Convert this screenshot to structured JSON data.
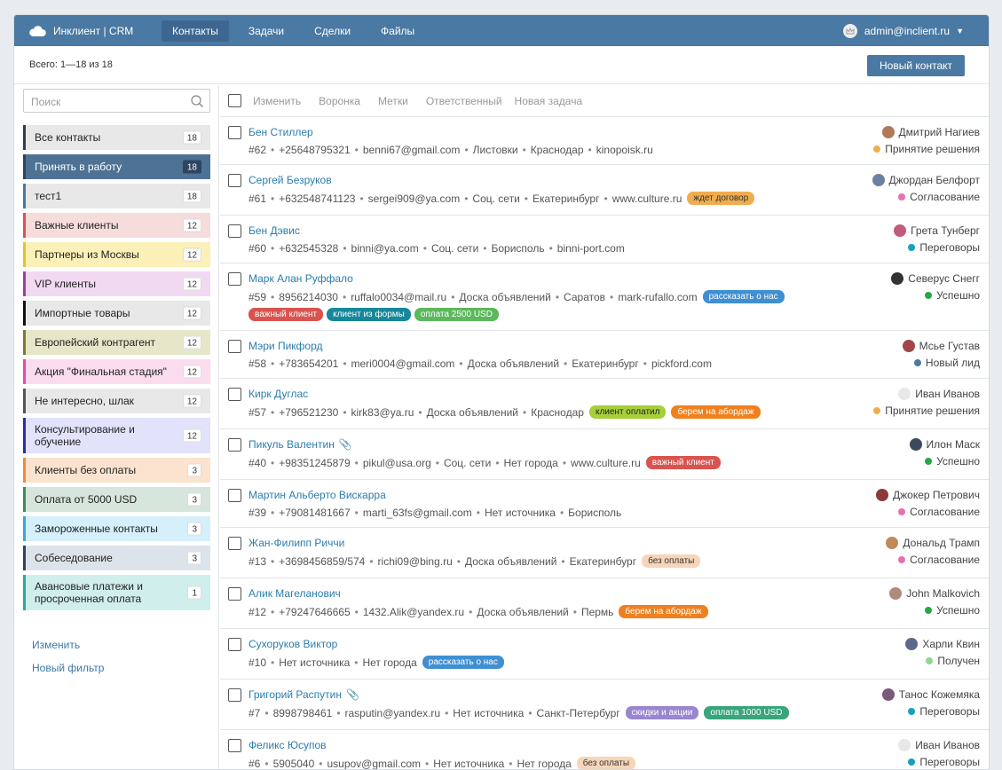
{
  "app": {
    "brand": "Инклиент | CRM"
  },
  "nav": [
    {
      "label": "Контакты",
      "active": true
    },
    {
      "label": "Задачи",
      "active": false
    },
    {
      "label": "Сделки",
      "active": false
    },
    {
      "label": "Файлы",
      "active": false
    }
  ],
  "user": {
    "email": "admin@inclient.ru"
  },
  "summary": {
    "total": "Всего: 1—18 из 18",
    "new_contact": "Новый контакт"
  },
  "search": {
    "placeholder": "Поиск"
  },
  "filters": [
    {
      "label": "Все контакты",
      "count": "18",
      "bg": "#e8e8e8",
      "border": "#2d3e50",
      "active": false
    },
    {
      "label": "Принять в работу",
      "count": "18",
      "bg": "#4e7294",
      "border": "#2d4560",
      "active": true
    },
    {
      "label": "тест1",
      "count": "18",
      "bg": "#e8e8e8",
      "border": "#4a79a3",
      "active": false
    },
    {
      "label": "Важные клиенты",
      "count": "12",
      "bg": "#f7dcdc",
      "border": "#d9534f",
      "active": false
    },
    {
      "label": "Партнеры из Москвы",
      "count": "12",
      "bg": "#fbf1b8",
      "border": "#e6c229",
      "active": false
    },
    {
      "label": "VIP клиенты",
      "count": "12",
      "bg": "#f1daf1",
      "border": "#9b3fa0",
      "active": false
    },
    {
      "label": "Импортные товары",
      "count": "12",
      "bg": "#e8e8e8",
      "border": "#111111",
      "active": false
    },
    {
      "label": "Европейский контрагент",
      "count": "12",
      "bg": "#e6e6c9",
      "border": "#7c7a2e",
      "active": false
    },
    {
      "label": "Акция \"Финальная стадия\"",
      "count": "12",
      "bg": "#fbdcee",
      "border": "#e84aa5",
      "active": false
    },
    {
      "label": "Не интересно, шлак",
      "count": "12",
      "bg": "#e8e8e8",
      "border": "#555555",
      "active": false
    },
    {
      "label": "Консультирование и обучение",
      "count": "12",
      "bg": "#e2e2fb",
      "border": "#2b2bb0",
      "active": false
    },
    {
      "label": "Клиенты без оплаты",
      "count": "3",
      "bg": "#fbe3cf",
      "border": "#f08a3c",
      "active": false
    },
    {
      "label": "Оплата от 5000 USD",
      "count": "3",
      "bg": "#d6e6dc",
      "border": "#3e8a5c",
      "active": false
    },
    {
      "label": "Замороженные контакты",
      "count": "3",
      "bg": "#d5effb",
      "border": "#3aa5d9",
      "active": false
    },
    {
      "label": "Собеседование",
      "count": "3",
      "bg": "#dde3ea",
      "border": "#2d4560",
      "active": false
    },
    {
      "label": "Авансовые платежи и просроченная оплата",
      "count": "1",
      "bg": "#cfeeec",
      "border": "#2aa79b",
      "active": false
    }
  ],
  "side_links": {
    "edit": "Изменить",
    "new_filter": "Новый фильтр"
  },
  "toolbar": {
    "edit": "Изменить",
    "funnel": "Воронка",
    "tags": "Метки",
    "responsible": "Ответственный",
    "new_task": "Новая задача"
  },
  "contacts": [
    {
      "name": "Бен Стиллер",
      "clip": false,
      "details": [
        "#62",
        "+25648795321",
        "benni67@gmail.com",
        "Листовки",
        "Краснодар",
        "kinopoisk.ru"
      ],
      "tags": [],
      "tags2": [],
      "owner": "Дмитрий Нагиев",
      "owner_color": "#b07a5a",
      "stage": "Принятие решения",
      "stage_color": "#f0ad4e"
    },
    {
      "name": "Сергей Безруков",
      "clip": false,
      "details": [
        "#61",
        "+632548741123",
        "sergei909@ya.com",
        "Соц. сети",
        "Екатеринбург",
        "www.culture.ru"
      ],
      "tags": [
        {
          "t": "ждет договор",
          "c": "#f0ad4e",
          "fg": "#333"
        }
      ],
      "tags2": [],
      "owner": "Джордан Белфорт",
      "owner_color": "#6c7fa0",
      "stage": "Согласование",
      "stage_color": "#e86fb2"
    },
    {
      "name": "Бен Дэвис",
      "clip": false,
      "details": [
        "#60",
        "+632545328",
        "binni@ya.com",
        "Соц. сети",
        "Борисполь",
        "binni-port.com"
      ],
      "tags": [],
      "tags2": [],
      "owner": "Грета Тунберг",
      "owner_color": "#c25a7a",
      "stage": "Переговоры",
      "stage_color": "#17a2b8"
    },
    {
      "name": "Марк Алан Руффало",
      "clip": false,
      "details": [
        "#59",
        "8956214030",
        "ruffalo0034@mail.ru",
        "Доска объявлений",
        "Саратов",
        "mark-rufallo.com"
      ],
      "tags": [
        {
          "t": "рассказать о нас",
          "c": "#3f8fd2",
          "fg": "#fff"
        }
      ],
      "tags2": [
        {
          "t": "важный клиент",
          "c": "#d9534f",
          "fg": "#fff"
        },
        {
          "t": "клиент из формы",
          "c": "#17879a",
          "fg": "#fff"
        },
        {
          "t": "оплата 2500 USD",
          "c": "#5cb85c",
          "fg": "#fff"
        }
      ],
      "owner": "Северус Снегг",
      "owner_color": "#333",
      "stage": "Успешно",
      "stage_color": "#28a745"
    },
    {
      "name": "Мэри Пикфорд",
      "clip": false,
      "details": [
        "#58",
        "+783654201",
        "meri0004@gmail.com",
        "Доска объявлений",
        "Екатеринбург",
        "pickford.com"
      ],
      "tags": [],
      "tags2": [],
      "owner": "Мсье Густав",
      "owner_color": "#a0474a",
      "stage": "Новый лид",
      "stage_color": "#4a79a3"
    },
    {
      "name": "Кирк Дуглас",
      "clip": false,
      "details": [
        "#57",
        "+796521230",
        "kirk83@ya.ru",
        "Доска объявлений",
        "Краснодар"
      ],
      "tags": [
        {
          "t": "клиент оплатил",
          "c": "#a6cf3a",
          "fg": "#222"
        },
        {
          "t": "берем на абордаж",
          "c": "#f0801e",
          "fg": "#fff"
        }
      ],
      "tags2": [],
      "owner": "Иван Иванов",
      "owner_color": "#e8e8e8",
      "stage": "Принятие решения",
      "stage_color": "#f0ad4e"
    },
    {
      "name": "Пикуль Валентин",
      "clip": true,
      "details": [
        "#40",
        "+98351245879",
        "pikul@usa.org",
        "Соц. сети",
        "Нет города",
        "www.culture.ru"
      ],
      "tags": [
        {
          "t": "важный клиент",
          "c": "#d9534f",
          "fg": "#fff"
        }
      ],
      "tags2": [],
      "owner": "Илон Маск",
      "owner_color": "#3a4a5a",
      "stage": "Успешно",
      "stage_color": "#28a745"
    },
    {
      "name": "Мартин Альберто Вискарра",
      "clip": false,
      "details": [
        "#39",
        "+79081481667",
        "marti_63fs@gmail.com",
        "Нет источника",
        "Борисполь"
      ],
      "tags": [],
      "tags2": [],
      "owner": "Джокер Петрович",
      "owner_color": "#8a3a3a",
      "stage": "Согласование",
      "stage_color": "#e86fb2"
    },
    {
      "name": "Жан-Филипп Риччи",
      "clip": false,
      "details": [
        "#13",
        "+3698456859/574",
        "richi09@bing.ru",
        "Доска объявлений",
        "Екатеринбург"
      ],
      "tags": [
        {
          "t": "без оплаты",
          "c": "#f6d5b8",
          "fg": "#333"
        }
      ],
      "tags2": [],
      "owner": "Дональд Трамп",
      "owner_color": "#c08a5a",
      "stage": "Согласование",
      "stage_color": "#e86fb2"
    },
    {
      "name": "Алик Магеланович",
      "clip": false,
      "details": [
        "#12",
        "+79247646665",
        "1432.Alik@yandex.ru",
        "Доска объявлений",
        "Пермь"
      ],
      "tags": [
        {
          "t": "берем на абордаж",
          "c": "#f0801e",
          "fg": "#fff"
        }
      ],
      "tags2": [],
      "owner": "John Malkovich",
      "owner_color": "#b08a7a",
      "stage": "Успешно",
      "stage_color": "#28a745"
    },
    {
      "name": "Сухоруков Виктор",
      "clip": false,
      "details": [
        "#10",
        "Нет источника",
        "Нет города"
      ],
      "tags": [
        {
          "t": "рассказать о нас",
          "c": "#3f8fd2",
          "fg": "#fff"
        }
      ],
      "tags2": [],
      "owner": "Харли Квин",
      "owner_color": "#5a6a8a",
      "stage": "Получен",
      "stage_color": "#8fd88f"
    },
    {
      "name": "Григорий Распутин",
      "clip": true,
      "details": [
        "#7",
        "8998798461",
        "rasputin@yandex.ru",
        "Нет источника",
        "Санкт-Петербург"
      ],
      "tags": [
        {
          "t": "скидки и акции",
          "c": "#9a86d0",
          "fg": "#fff"
        },
        {
          "t": "оплата 1000 USD",
          "c": "#3aa57a",
          "fg": "#fff"
        }
      ],
      "tags2": [],
      "owner": "Танос Кожемяка",
      "owner_color": "#7a5a7a",
      "stage": "Переговоры",
      "stage_color": "#17a2b8"
    },
    {
      "name": "Феликс Юсупов",
      "clip": false,
      "details": [
        "#6",
        "5905040",
        "usupov@gmail.com",
        "Нет источника",
        "Нет города"
      ],
      "tags": [
        {
          "t": "без оплаты",
          "c": "#f6d5b8",
          "fg": "#333"
        }
      ],
      "tags2": [],
      "owner": "Иван Иванов",
      "owner_color": "#e8e8e8",
      "stage": "Переговоры",
      "stage_color": "#17a2b8"
    }
  ]
}
